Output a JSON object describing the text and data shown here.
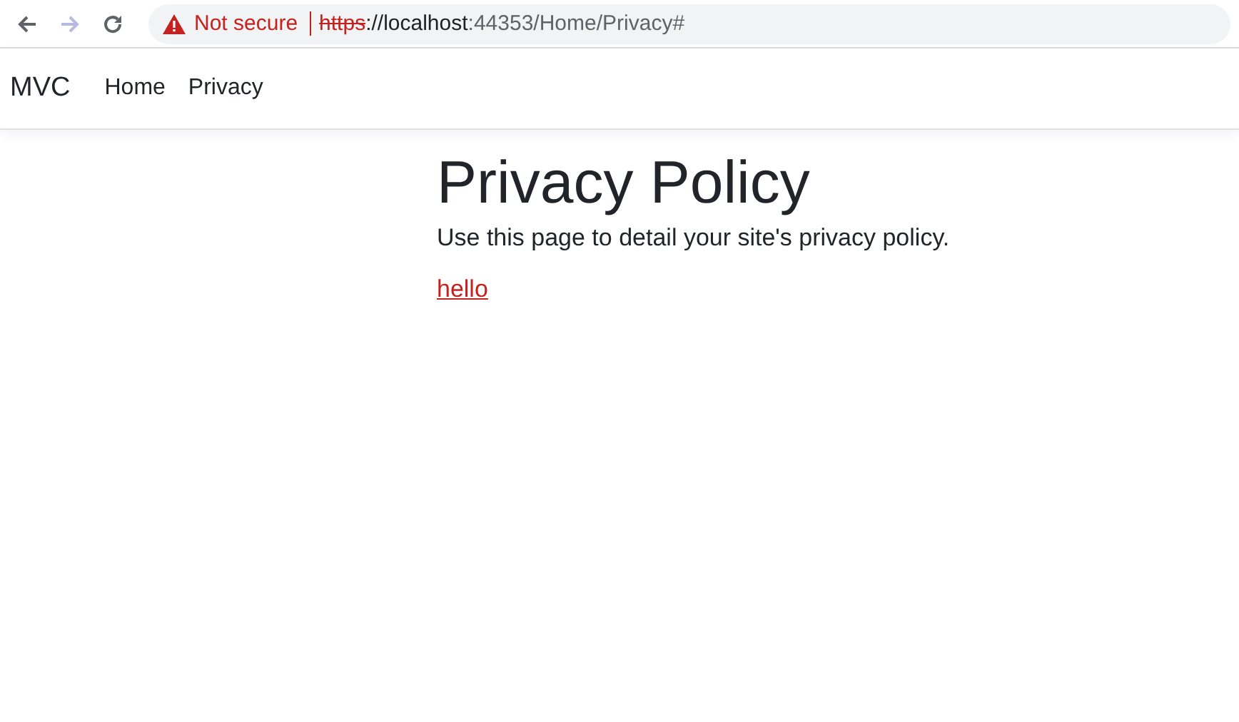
{
  "browser": {
    "back": {
      "disabled": false
    },
    "forward": {
      "disabled": true
    },
    "security": "Not secure",
    "url": {
      "scheme": "https",
      "host": "://localhost",
      "rest": ":44353/Home/Privacy#"
    }
  },
  "navbar": {
    "brand": "MVC",
    "links": [
      {
        "label": "Home"
      },
      {
        "label": "Privacy"
      }
    ]
  },
  "main": {
    "title": "Privacy Policy",
    "text": "Use this page to detail your site's privacy policy.",
    "link": "hello"
  }
}
